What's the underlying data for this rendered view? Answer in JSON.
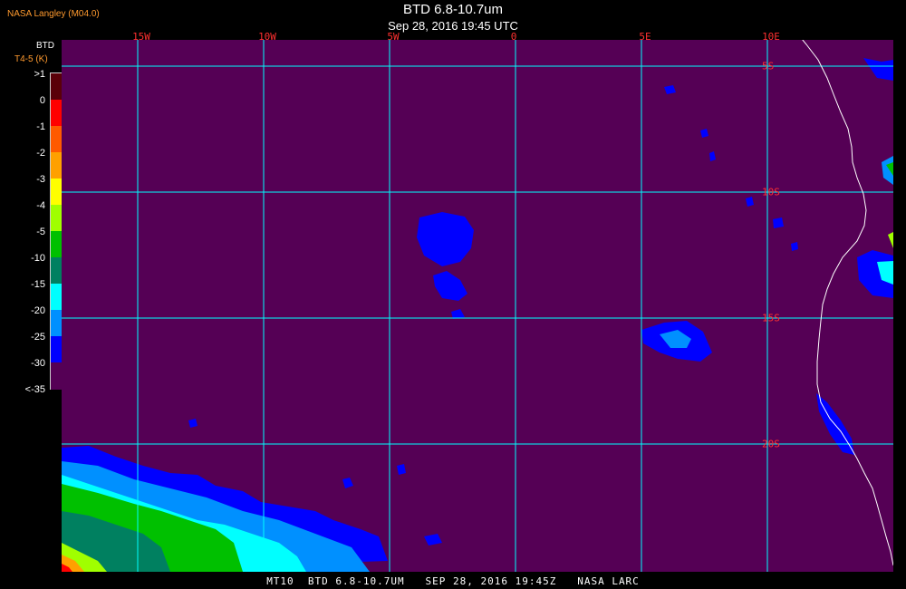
{
  "credit": "NASA Langley (M04.0)",
  "title": "BTD 6.8-10.7um",
  "subtitle": "Sep 28, 2016 19:45 UTC",
  "legend": {
    "title": "BTD",
    "units": "T4-5 (K)",
    "ticks": [
      ">1",
      "0",
      "-1",
      "-2",
      "-3",
      "-4",
      "-5",
      "-10",
      "-15",
      "-20",
      "-25",
      "-30",
      "<-35"
    ],
    "colors": [
      "#5a0008",
      "#ff0000",
      "#ff5a00",
      "#ffa000",
      "#ffff00",
      "#a0ff00",
      "#00c000",
      "#008060",
      "#00ffff",
      "#0090ff",
      "#0000ff",
      "#550055"
    ]
  },
  "map": {
    "background_color": "#550055",
    "grid_color": "#00ffff",
    "coastline_color": "#ffffff",
    "longitude_labels": [
      "15W",
      "10W",
      "5W",
      "0",
      "5E",
      "10E"
    ],
    "latitude_labels": [
      "5S",
      "10S",
      "15S",
      "20S"
    ]
  },
  "footer": "MT10  BTD 6.8-10.7UM   SEP 28, 2016 19:45Z   NASA LARC"
}
